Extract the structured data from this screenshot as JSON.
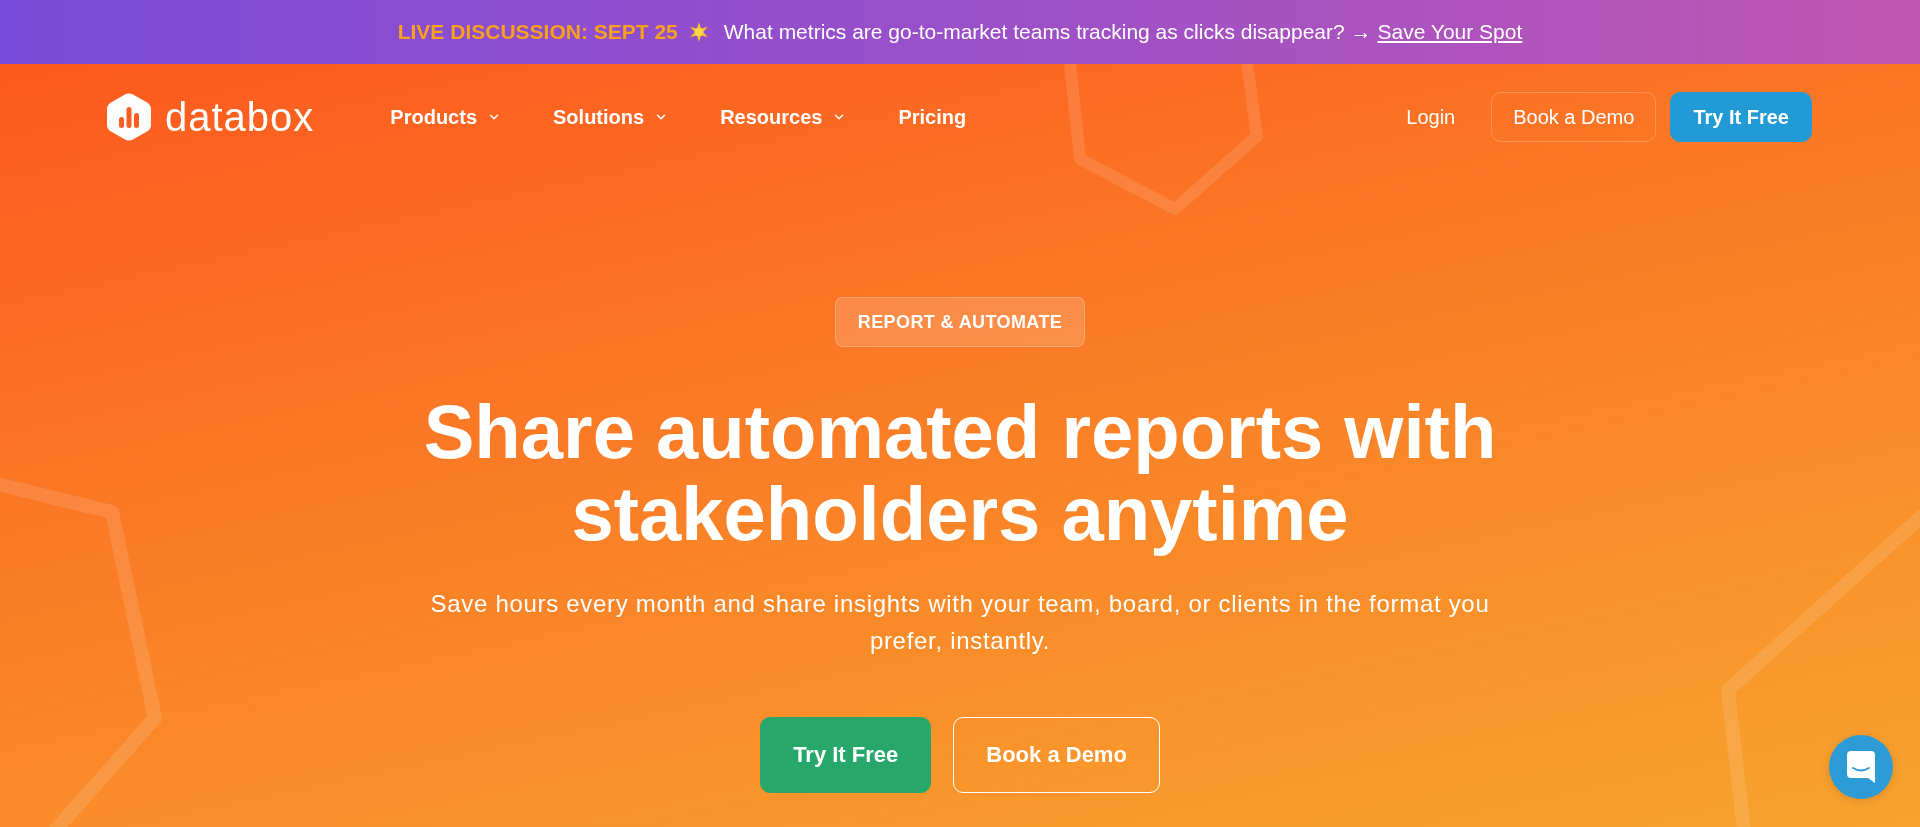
{
  "announcement": {
    "label": "LIVE DISCUSSION: SEPT 25",
    "message": "What metrics are go-to-market teams tracking as clicks disappear? →",
    "link": "Save Your Spot"
  },
  "nav": {
    "logo": "databox",
    "items": [
      {
        "label": "Products",
        "dropdown": true
      },
      {
        "label": "Solutions",
        "dropdown": true
      },
      {
        "label": "Resources",
        "dropdown": true
      },
      {
        "label": "Pricing",
        "dropdown": false
      }
    ],
    "login": "Login",
    "buttons": [
      {
        "label": "Book a Demo",
        "kind": "outline"
      },
      {
        "label": "Try It Free",
        "kind": "filled"
      }
    ]
  },
  "hero": {
    "badge": "REPORT & AUTOMATE",
    "title": "Share automated reports with stakeholders anytime",
    "subtitle": "Save hours every month and share insights with your team, board, or clients in the format you prefer, instantly.",
    "buttons": [
      {
        "label": "Try It Free",
        "kind": "filled"
      },
      {
        "label": "Book a Demo",
        "kind": "outline"
      }
    ]
  }
}
